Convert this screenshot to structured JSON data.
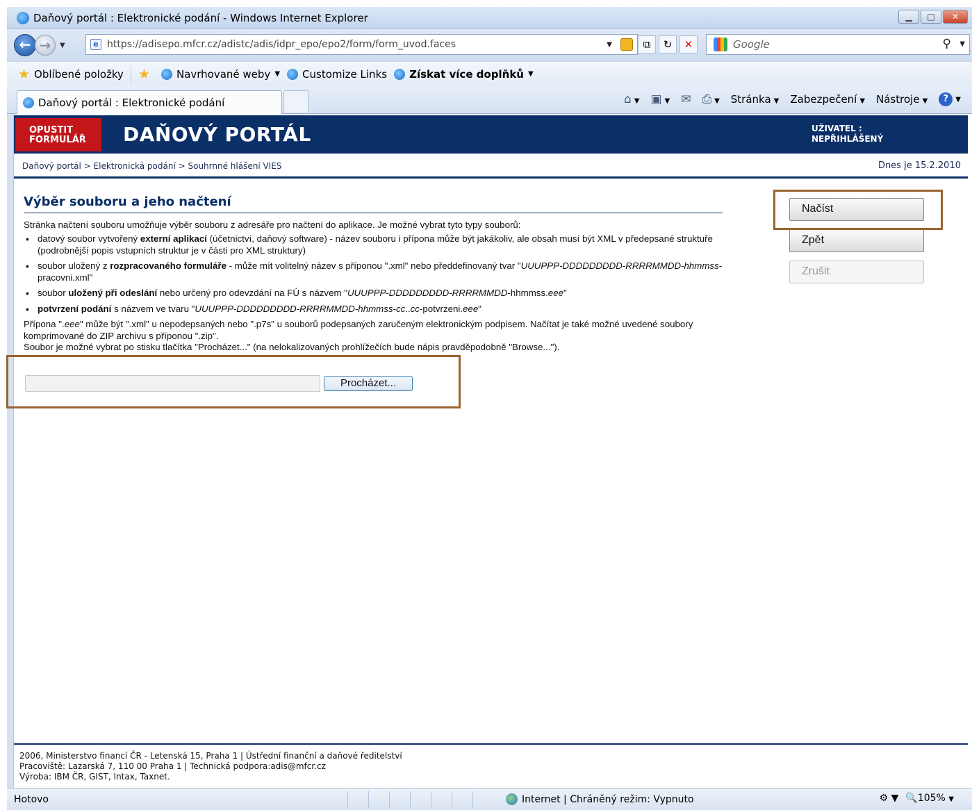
{
  "window": {
    "title": "Daňový portál : Elektronické podání - Windows Internet Explorer"
  },
  "address": {
    "url": "https://adisepo.mfcr.cz/adistc/adis/idpr_epo/epo2/form/form_uvod.faces",
    "search_placeholder": "Google"
  },
  "favorites": {
    "label": "Oblíbené položky",
    "items": [
      "Navrhované weby",
      "Customize Links",
      "Získat více doplňků"
    ]
  },
  "tab": {
    "title": "Daňový portál : Elektronické podání"
  },
  "commandbar": {
    "page": "Stránka",
    "security": "Zabezpečení",
    "tools": "Nástroje"
  },
  "portal": {
    "exit_line1": "OPUSTIT",
    "exit_line2": "FORMULÁŘ",
    "title": "DAŇOVÝ PORTÁL",
    "user_line1": "UŽIVATEL :",
    "user_line2": "NEPŘIHLÁŠENÝ",
    "breadcrumb": "Daňový portál > Elektronická podání > Souhrnné hlášení VIES",
    "date": "Dnes je 15.2.2010"
  },
  "content": {
    "heading": "Výběr souboru a jeho načtení",
    "intro": "Stránka načtení souboru umožňuje výběr souboru z adresáře pro načtení do aplikace. Je možné vybrat tyto typy souborů:",
    "items": [
      {
        "pre": "datový soubor vytvořený ",
        "bold": "externí aplikací",
        "post": " (účetnictví, daňový software) - název souboru i přípona může být jakákoliv, ale obsah musí být XML v předepsané struktuře (podrobnější popis vstupních struktur je v části pro XML struktury)"
      },
      {
        "pre": "soubor uložený z ",
        "bold": "rozpracovaného formuláře",
        "post": " - může mít volitelný název s příponou \".xml\" nebo předdefinovaný tvar \"",
        "italic": "UUUPPP-DDDDDDDDD-RRRRMMDD-hhmmss",
        "post2": "-pracovni.xml\""
      },
      {
        "pre": "soubor ",
        "bold": "uložený při odeslání",
        "post": " nebo určený pro odevzdání na FÚ s názvem \"",
        "italic": "UUUPPP-DDDDDDDDD-RRRRMMDD",
        "post2": "-hhmmss.",
        "italic2": "eee",
        "post3": "\""
      },
      {
        "pre": "",
        "bold": "potvrzení podání",
        "post": " s názvem ve tvaru \"",
        "italic": "UUUPPP-DDDDDDDDD-RRRRMMDD-hhmmss-cc",
        "post2": "..",
        "italic2": "cc",
        "post3": "-potvrzeni.",
        "italic3": "eee",
        "post4": "\""
      }
    ],
    "note1_pre": "Přípona \".",
    "note1_italic": "eee",
    "note1_post": "\" může být \".xml\" u nepodepsaných nebo \".p7s\" u souborů podepsaných zaručeným elektronickým podpisem. Načítat je také možné uvedené soubory komprimované do ZIP archivu s příponou \".zip\".",
    "note2": "Soubor je možné vybrat po stisku tlačítka \"Procházet...\" (na nelokalizovaných prohlížečích bude nápis pravděpodobně \"Browse...\").",
    "file_value": "",
    "browse_label": "Procházet..."
  },
  "actions": {
    "load": "Načíst",
    "back": "Zpět",
    "cancel": "Zrušit"
  },
  "footer": {
    "line1": "2006, Ministerstvo financí ČR - Letenská 15, Praha 1 | Ústřední finanční a daňové ředitelství",
    "line2": "Pracoviště: Lazarská 7, 110 00 Praha 1 | Technická podpora:adis@mfcr.cz",
    "line3": "Výroba: IBM ČR, GIST, Intax, Taxnet."
  },
  "status": {
    "text": "Hotovo",
    "zone": "Internet | Chráněný režim: Vypnuto",
    "zoom": "105%"
  },
  "colors": {
    "portal_navy": "#0b2f67",
    "exit_red": "#c2161a",
    "highlight_brown": "#9a6330"
  }
}
